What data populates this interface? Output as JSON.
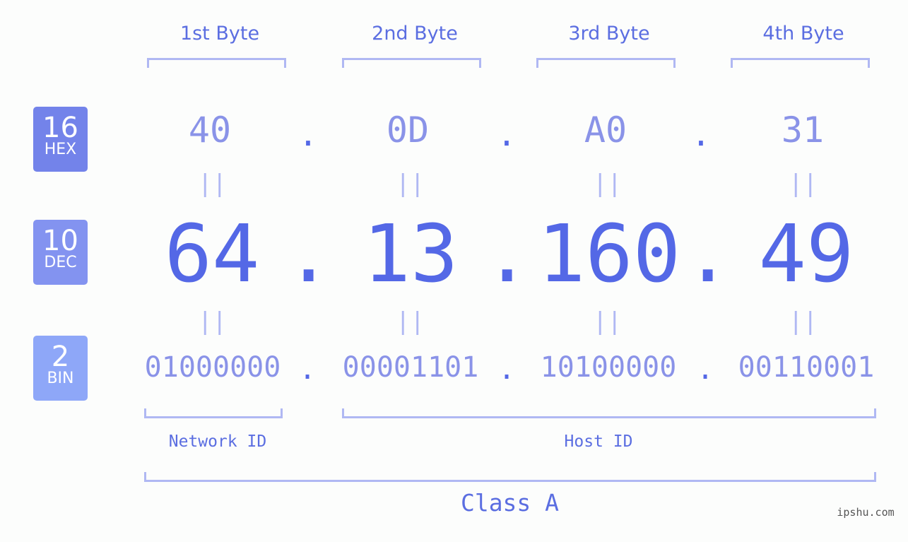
{
  "bases": [
    {
      "num": "16",
      "label": "HEX",
      "color": "#7383ea"
    },
    {
      "num": "10",
      "label": "DEC",
      "color": "#8393f0"
    },
    {
      "num": "2",
      "label": "BIN",
      "color": "#8ea7f8"
    }
  ],
  "byte_labels": [
    "1st Byte",
    "2nd Byte",
    "3rd Byte",
    "4th Byte"
  ],
  "hex": [
    "40",
    "0D",
    "A0",
    "31"
  ],
  "dec": [
    "64",
    "13",
    "160",
    "49"
  ],
  "bin": [
    "01000000",
    "00001101",
    "10100000",
    "00110001"
  ],
  "separator": ".",
  "equals": "||",
  "parts": {
    "network": "Network ID",
    "host": "Host ID"
  },
  "class_label": "Class A",
  "watermark": "ipshu.com"
}
